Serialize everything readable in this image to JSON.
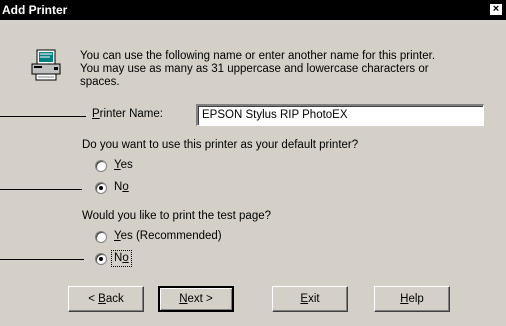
{
  "window": {
    "title": "Add Printer",
    "close_label": "×"
  },
  "intro": {
    "line1": "You can use the following name or enter another name for this printer.",
    "line2": "You may use as many as 31 uppercase and lowercase characters or",
    "line3": "spaces."
  },
  "printer_name": {
    "label_accel": "P",
    "label_rest": "rinter Name:",
    "value": "EPSON Stylus RIP PhotoEX"
  },
  "default_printer": {
    "question": "Do you want to use this printer as your default printer?",
    "yes_accel": "Y",
    "yes_rest": "es",
    "no_pre": "N",
    "no_accel": "o",
    "selected": "No"
  },
  "test_page": {
    "question": "Would you like to print the test page?",
    "yes_accel": "Y",
    "yes_rest": "es (Recommended)",
    "no_pre": "N",
    "no_accel": "o",
    "selected": "No"
  },
  "buttons": {
    "back_pre": "< ",
    "back_accel": "B",
    "back_rest": "ack",
    "next_accel": "N",
    "next_rest": "ext >",
    "exit_accel": "E",
    "exit_rest": "xit",
    "help_accel": "H",
    "help_rest": "elp"
  }
}
